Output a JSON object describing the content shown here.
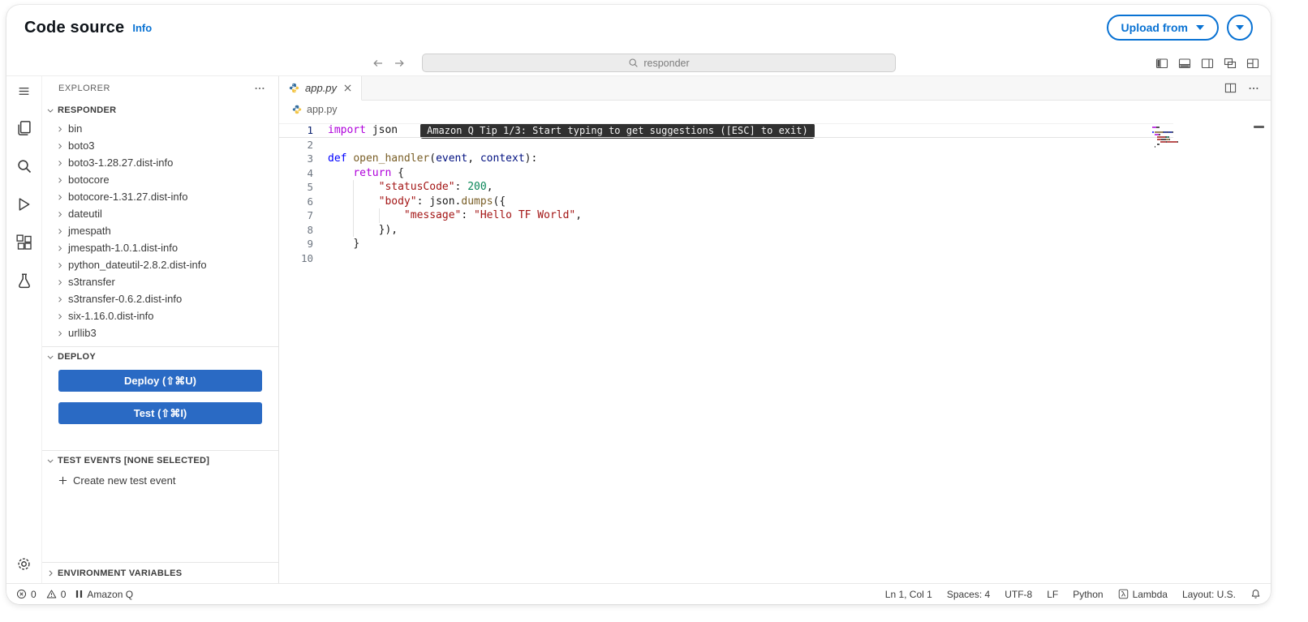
{
  "header": {
    "title": "Code source",
    "info": "Info",
    "upload_from": "Upload from"
  },
  "toolbar": {
    "search": "responder"
  },
  "explorer": {
    "title": "EXPLORER",
    "sections": {
      "root": "RESPONDER",
      "deploy": "DEPLOY",
      "test_events": "TEST EVENTS [NONE SELECTED]",
      "env": "ENVIRONMENT VARIABLES"
    },
    "items": [
      "bin",
      "boto3",
      "boto3-1.28.27.dist-info",
      "botocore",
      "botocore-1.31.27.dist-info",
      "dateutil",
      "jmespath",
      "jmespath-1.0.1.dist-info",
      "python_dateutil-2.8.2.dist-info",
      "s3transfer",
      "s3transfer-0.6.2.dist-info",
      "six-1.16.0.dist-info",
      "urllib3"
    ],
    "deploy_button": "Deploy (⇧⌘U)",
    "test_button": "Test (⇧⌘I)",
    "create_test_event": "Create new test event"
  },
  "editor": {
    "tab": "app.py",
    "breadcrumb": "app.py",
    "tooltip": {
      "line": 1,
      "text": "Amazon Q Tip 1/3: Start typing to get suggestions ([ESC] to exit)"
    },
    "code": {
      "language": "python",
      "lines": [
        {
          "tokens": [
            {
              "t": "import",
              "c": "kw"
            },
            {
              "t": " json",
              "c": "plain"
            }
          ]
        },
        {
          "tokens": []
        },
        {
          "tokens": [
            {
              "t": "def",
              "c": "def"
            },
            {
              "t": " ",
              "c": "plain"
            },
            {
              "t": "open_handler",
              "c": "fn"
            },
            {
              "t": "(",
              "c": "plain"
            },
            {
              "t": "event",
              "c": "param"
            },
            {
              "t": ", ",
              "c": "plain"
            },
            {
              "t": "context",
              "c": "param"
            },
            {
              "t": "):",
              "c": "plain"
            }
          ]
        },
        {
          "tokens": [
            {
              "t": "    ",
              "c": "plain"
            },
            {
              "t": "return",
              "c": "kw"
            },
            {
              "t": " {",
              "c": "plain"
            }
          ]
        },
        {
          "tokens": [
            {
              "t": "        ",
              "c": "plain"
            },
            {
              "t": "\"statusCode\"",
              "c": "str"
            },
            {
              "t": ": ",
              "c": "plain"
            },
            {
              "t": "200",
              "c": "num"
            },
            {
              "t": ",",
              "c": "plain"
            }
          ]
        },
        {
          "tokens": [
            {
              "t": "        ",
              "c": "plain"
            },
            {
              "t": "\"body\"",
              "c": "str"
            },
            {
              "t": ": ",
              "c": "plain"
            },
            {
              "t": "json.",
              "c": "plain"
            },
            {
              "t": "dumps",
              "c": "fn"
            },
            {
              "t": "({",
              "c": "plain"
            }
          ]
        },
        {
          "tokens": [
            {
              "t": "            ",
              "c": "plain"
            },
            {
              "t": "\"message\"",
              "c": "str"
            },
            {
              "t": ": ",
              "c": "plain"
            },
            {
              "t": "\"Hello TF World\"",
              "c": "str"
            },
            {
              "t": ",",
              "c": "plain"
            }
          ]
        },
        {
          "tokens": [
            {
              "t": "        ",
              "c": "plain"
            },
            {
              "t": "}),",
              "c": "plain"
            }
          ]
        },
        {
          "tokens": [
            {
              "t": "    ",
              "c": "plain"
            },
            {
              "t": "}",
              "c": "plain"
            }
          ]
        },
        {
          "tokens": []
        }
      ]
    }
  },
  "status_bar": {
    "errors": "0",
    "warnings": "0",
    "amazon_q": "Amazon Q",
    "cursor": "Ln 1, Col 1",
    "indent": "Spaces: 4",
    "encoding": "UTF-8",
    "eol": "LF",
    "language": "Python",
    "runtime": "Lambda",
    "layout": "Layout: U.S."
  },
  "icons": {
    "menu": "hamburger",
    "explorer": "files",
    "search": "magnifier",
    "run_debug": "play",
    "extensions": "squares",
    "aws_toolkit": "beaker",
    "settings": "gear",
    "error": "circle-x",
    "warning": "triangle-exclamation",
    "pause": "pause-bars",
    "lambda": "lambda-box",
    "bell": "bell",
    "python": "python-logo"
  },
  "colors": {
    "aws_blue": "#0972d3",
    "button_blue": "#2a6ac4",
    "tooltip_bg": "#303030",
    "tooltip_fg": "#f2f2f2",
    "syntax": {
      "kw": "#AF00DB",
      "def": "#0000FF",
      "fn": "#795E26",
      "param": "#001080",
      "str": "#A31515",
      "num": "#098658",
      "plain": "#1b1b1b"
    }
  }
}
